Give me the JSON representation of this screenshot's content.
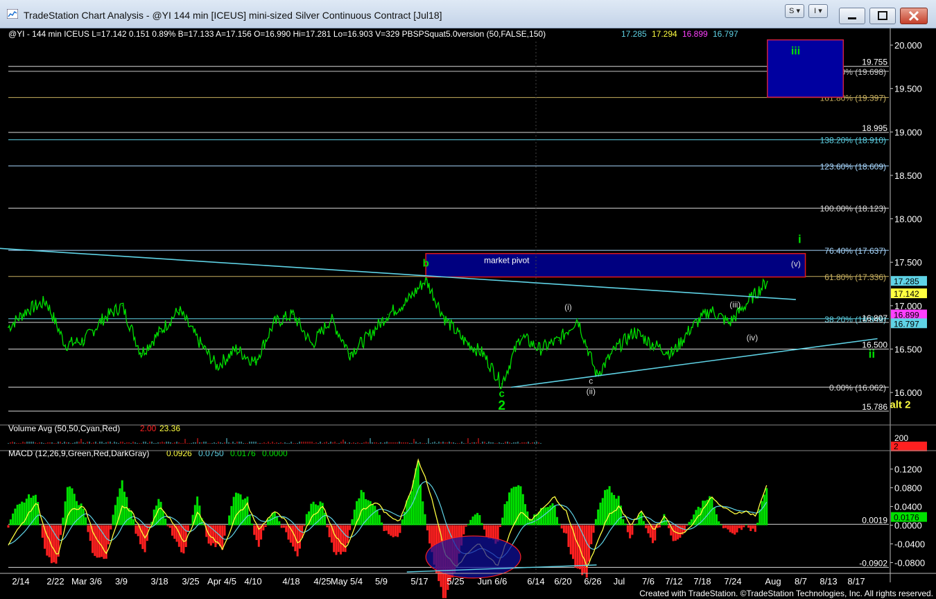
{
  "window": {
    "title": "TradeStation Chart Analysis - @YI 144 min [ICEUS] mini-sized Silver Continuous Contract [Jul18]",
    "buttons": [
      "S",
      "I"
    ],
    "footer": "Created with TradeStation. ©TradeStation Technologies, Inc. All rights reserved."
  },
  "colors": {
    "price": "#00e000",
    "fib_line": "#a8d8ff",
    "trend_line": "#5fd3e6",
    "pivot_box": "#000080",
    "pivot_border": "#e01818",
    "macd": "#ffff40",
    "signal": "#5fd3e6",
    "hist_pos": "#00e000",
    "hist_neg": "#ff2020"
  },
  "header": {
    "main": "@YI - 144 min  ICEUS  L=17.142  0.151  0.89%  B=17.133  A=17.156  O=16.990  Hi=17.281  Lo=16.903  V=329  PBSPSquat5.0version (50,FALSE,150)",
    "vals": [
      "17.285",
      "17.294",
      "16.899",
      "16.797"
    ],
    "val_colors": [
      "#5fd3e6",
      "#ffff40",
      "#ff40ff",
      "#5fd3e6"
    ]
  },
  "chart_data": [
    {
      "type": "line",
      "title": "@YI - 144 min ICEUS",
      "ylim": [
        15.65,
        20.2
      ],
      "yticks": [
        "20.000",
        "19.500",
        "19.000",
        "18.500",
        "18.000",
        "17.500",
        "17.000",
        "16.500",
        "16.000"
      ],
      "ytick_values": [
        20.0,
        19.5,
        19.0,
        18.5,
        18.0,
        17.5,
        17.0,
        16.5,
        16.0
      ],
      "x_dates": [
        "2/14",
        "2/22",
        "Mar 3/6",
        "3/9",
        "3/18",
        "3/25",
        "Apr 4/5",
        "4/10",
        "4/18",
        "4/25",
        "May 5/4",
        "5/9",
        "5/17",
        "5/25",
        "Jun 6/6",
        "6/14",
        "6/20",
        "6/26",
        "Jul",
        "7/6",
        "7/12",
        "7/18",
        "7/24",
        "Aug",
        "8/7",
        "8/13",
        "8/17"
      ],
      "price_anchors": [
        [
          0,
          16.75
        ],
        [
          1,
          16.95
        ],
        [
          2,
          17.05
        ],
        [
          3,
          16.55
        ],
        [
          4,
          16.6
        ],
        [
          5,
          16.85
        ],
        [
          6,
          17.0
        ],
        [
          7,
          16.45
        ],
        [
          8,
          16.7
        ],
        [
          9,
          16.95
        ],
        [
          10,
          16.6
        ],
        [
          11,
          16.3
        ],
        [
          12,
          16.5
        ],
        [
          13,
          16.35
        ],
        [
          14,
          16.8
        ],
        [
          15,
          16.9
        ],
        [
          16,
          16.55
        ],
        [
          17,
          16.85
        ],
        [
          18,
          16.45
        ],
        [
          19,
          16.65
        ],
        [
          20,
          16.9
        ],
        [
          21,
          17.05
        ],
        [
          22,
          17.3
        ],
        [
          23,
          16.85
        ],
        [
          24,
          16.6
        ],
        [
          25,
          16.45
        ],
        [
          26,
          16.1
        ],
        [
          27,
          16.65
        ],
        [
          28,
          16.5
        ],
        [
          29,
          16.6
        ],
        [
          30,
          16.85
        ],
        [
          31,
          16.2
        ],
        [
          32,
          16.5
        ],
        [
          33,
          16.7
        ],
        [
          34,
          16.55
        ],
        [
          35,
          16.45
        ],
        [
          36,
          16.75
        ],
        [
          37,
          16.95
        ],
        [
          38,
          16.8
        ],
        [
          39,
          17.05
        ],
        [
          40,
          17.28
        ]
      ],
      "anchor_dates": [
        "2/14",
        "",
        "2/22",
        "",
        "",
        "Mar 3/6",
        "",
        "",
        "3/18",
        "",
        "3/25",
        "",
        "",
        "Apr 4/5",
        "",
        "4/10",
        "",
        "",
        "",
        "",
        "",
        "4/18",
        "",
        "",
        "4/25",
        "",
        "May 5/4",
        "",
        "5/9",
        "",
        "",
        "5/17",
        "",
        "5/25",
        "",
        "",
        "Jun 6/6",
        "",
        "",
        "",
        "6/14"
      ],
      "fib_levels": [
        {
          "label": "176.40% (19.698)",
          "value": 19.698,
          "color": "#c8c8c8"
        },
        {
          "label": "161.80% (19.397)",
          "value": 19.397,
          "color": "#c8b060"
        },
        {
          "label": "138.20% (18.910)",
          "value": 18.91,
          "color": "#5fd3e6"
        },
        {
          "label": "123.60% (18.609)",
          "value": 18.609,
          "color": "#a8d8ff"
        },
        {
          "label": "100.00% (18.123)",
          "value": 18.123,
          "color": "#dcdcdc"
        },
        {
          "label": "76.40% (17.637)",
          "value": 17.637,
          "color": "#a8d8ff"
        },
        {
          "label": "61.80% (17.336)",
          "value": 17.336,
          "color": "#c8b060"
        },
        {
          "label": "38.20% (16.849)",
          "value": 16.849,
          "color": "#5fd3e6"
        },
        {
          "label": "0.00% (16.062)",
          "value": 16.062,
          "color": "#dcdcdc"
        }
      ],
      "price_lines": [
        {
          "label": "19.755",
          "value": 19.755
        },
        {
          "label": "18.995",
          "value": 18.995
        },
        {
          "label": "16.807",
          "value": 16.807
        },
        {
          "label": "16.500",
          "value": 16.5
        },
        {
          "label": "15.786",
          "value": 15.786
        }
      ],
      "last_value_tags": [
        {
          "label": "17.285",
          "value": 17.285,
          "color": "#5fd3e6",
          "text": "#000"
        },
        {
          "label": "17.142",
          "value": 17.142,
          "color": "#ffff40",
          "text": "#000"
        },
        {
          "label": "16.899",
          "value": 16.899,
          "color": "#ff40ff",
          "text": "#000"
        },
        {
          "label": "16.797",
          "value": 16.797,
          "color": "#5fd3e6",
          "text": "#000"
        }
      ],
      "target_box": {
        "label": "iii",
        "top": 20.06,
        "bottom": 19.4,
        "x_start": 40.0,
        "x_end": 44.0
      },
      "market_pivot": {
        "label": "market pivot",
        "top": 17.6,
        "bottom": 17.33,
        "x_start": 22.0,
        "x_end": 42.0
      },
      "wave_labels": [
        {
          "text": "b",
          "x": 22.0,
          "y": 17.45,
          "color": "#00e000",
          "size": 15
        },
        {
          "text": "c",
          "x": 26.0,
          "y": 15.95,
          "color": "#00e000",
          "size": 15
        },
        {
          "text": "2",
          "x": 26.0,
          "y": 15.8,
          "color": "#00e000",
          "size": 19
        },
        {
          "text": "(i)",
          "x": 29.5,
          "y": 16.95,
          "color": "#dcdcdc",
          "size": 12
        },
        {
          "text": "c",
          "x": 30.7,
          "y": 16.1,
          "color": "#dcdcdc",
          "size": 12
        },
        {
          "text": "(ii)",
          "x": 30.7,
          "y": 15.98,
          "color": "#dcdcdc",
          "size": 12
        },
        {
          "text": "(iii)",
          "x": 38.3,
          "y": 16.98,
          "color": "#dcdcdc",
          "size": 12
        },
        {
          "text": "(iv)",
          "x": 39.2,
          "y": 16.6,
          "color": "#dcdcdc",
          "size": 12
        },
        {
          "text": "(v)",
          "x": 41.5,
          "y": 17.45,
          "color": "#dcdcdc",
          "size": 12
        },
        {
          "text": "i",
          "x": 41.7,
          "y": 17.72,
          "color": "#00e000",
          "size": 17
        },
        {
          "text": "ii",
          "x": 45.5,
          "y": 16.4,
          "color": "#00e000",
          "size": 17
        },
        {
          "text": "alt 2",
          "x": 47.0,
          "y": 15.82,
          "color": "#ffff40",
          "size": 15
        }
      ],
      "trend_lines": [
        {
          "x1": -0.5,
          "y1": 17.66,
          "x2": 41.5,
          "y2": 17.07
        },
        {
          "x1": 26.5,
          "y1": 16.06,
          "x2": 45.8,
          "y2": 16.62
        }
      ]
    },
    {
      "type": "bar",
      "title": "Volume Avg (50,50,Cyan,Red)",
      "values_text": [
        "2.00",
        "23.36"
      ],
      "value_colors": [
        "#ff2020",
        "#ffff40"
      ],
      "ytick": "200",
      "last_tag": "2"
    },
    {
      "type": "line",
      "title": "MACD (12,26,9,Green,Red,DarkGray)",
      "values_text": [
        "0.0926",
        "0.0750",
        "0.0176",
        "0.0000"
      ],
      "value_colors": [
        "#ffff40",
        "#5fd3e6",
        "#00e000",
        "#00e000"
      ],
      "ylim": [
        -0.1,
        0.152
      ],
      "yticks": [
        "0.1200",
        "0.0800",
        "0.0400",
        "0.0000",
        "-0.0400",
        "-0.0800"
      ],
      "ytick_values": [
        0.12,
        0.08,
        0.04,
        0.0,
        -0.04,
        -0.08
      ],
      "level_lines": [
        {
          "label": "0.0019",
          "value": 0.0019
        },
        {
          "label": "-0.0902",
          "value": -0.0902
        }
      ],
      "last_tag": {
        "label": "0.0176",
        "value": 0.0176
      },
      "macd_anchors": [
        [
          0,
          -0.04
        ],
        [
          1,
          0.02
        ],
        [
          1.5,
          0.05
        ],
        [
          2,
          -0.02
        ],
        [
          2.6,
          -0.07
        ],
        [
          3.2,
          0.03
        ],
        [
          4,
          0.04
        ],
        [
          4.6,
          -0.03
        ],
        [
          5.2,
          -0.06
        ],
        [
          6,
          0.04
        ],
        [
          6.5,
          0.03
        ],
        [
          7.2,
          -0.03
        ],
        [
          8,
          0.04
        ],
        [
          8.6,
          0.01
        ],
        [
          9.3,
          -0.04
        ],
        [
          10,
          0.03
        ],
        [
          10.6,
          -0.02
        ],
        [
          11.3,
          -0.05
        ],
        [
          12,
          0.02
        ],
        [
          12.6,
          0.045
        ],
        [
          13.2,
          -0.01
        ],
        [
          14,
          0.03
        ],
        [
          14.6,
          0.01
        ],
        [
          15.3,
          -0.04
        ],
        [
          16,
          0.02
        ],
        [
          16.6,
          0.04
        ],
        [
          17.2,
          -0.02
        ],
        [
          17.8,
          -0.05
        ],
        [
          18.6,
          0.03
        ],
        [
          19.4,
          0.05
        ],
        [
          20,
          0.02
        ],
        [
          20.6,
          0.01
        ],
        [
          21.2,
          0.07
        ],
        [
          21.6,
          0.14
        ],
        [
          22,
          0.1
        ],
        [
          22.5,
          0.03
        ],
        [
          23,
          -0.06
        ],
        [
          23.6,
          -0.09
        ],
        [
          24.2,
          -0.06
        ],
        [
          24.8,
          -0.04
        ],
        [
          25.3,
          -0.07
        ],
        [
          25.8,
          -0.085
        ],
        [
          26.4,
          -0.02
        ],
        [
          27,
          0.03
        ],
        [
          27.6,
          0.01
        ],
        [
          28.2,
          0.04
        ],
        [
          28.8,
          0.06
        ],
        [
          29.4,
          0.03
        ],
        [
          30,
          -0.04
        ],
        [
          30.5,
          -0.09
        ],
        [
          31,
          -0.04
        ],
        [
          31.6,
          0.02
        ],
        [
          32.2,
          0.04
        ],
        [
          32.8,
          0.0
        ],
        [
          33.4,
          0.03
        ],
        [
          34,
          -0.01
        ],
        [
          34.6,
          0.02
        ],
        [
          35.2,
          -0.02
        ],
        [
          35.8,
          -0.01
        ],
        [
          36.4,
          0.02
        ],
        [
          37,
          0.06
        ],
        [
          37.6,
          0.04
        ],
        [
          38.2,
          0.025
        ],
        [
          38.8,
          0.03
        ],
        [
          39.4,
          0.02
        ],
        [
          40,
          0.09
        ]
      ],
      "ellipse": {
        "x_center": 24.5,
        "y_center": -0.068,
        "rx_units": 2.5,
        "ry_value": 0.045
      }
    }
  ]
}
